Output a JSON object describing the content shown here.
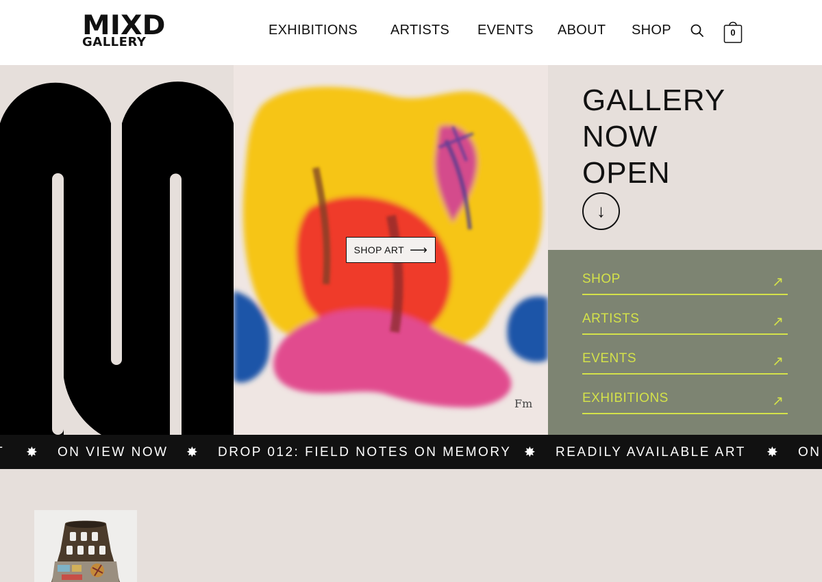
{
  "header": {
    "logo": {
      "main": "MIXD",
      "sub": "GALLERY"
    },
    "nav": [
      {
        "label": "EXHIBITIONS"
      },
      {
        "label": "ARTISTS"
      },
      {
        "label": "EVENTS"
      },
      {
        "label": "ABOUT"
      },
      {
        "label": "SHOP"
      }
    ],
    "search_icon": "search-icon",
    "cart": {
      "icon": "shopping-bag-icon",
      "count": "0"
    }
  },
  "hero": {
    "shop_button": {
      "label": "SHOP ART",
      "arrow": "⟶"
    },
    "title_lines": [
      "GALLERY",
      "NOW",
      "OPEN"
    ],
    "down_arrow": "↓"
  },
  "quick_links": [
    {
      "label": "SHOP",
      "arrow": "↗"
    },
    {
      "label": "ARTISTS",
      "arrow": "↗"
    },
    {
      "label": "EVENTS",
      "arrow": "↗"
    },
    {
      "label": "EXHIBITIONS",
      "arrow": "↗"
    }
  ],
  "marquee": {
    "leading": "T",
    "star": "✸",
    "items": [
      "ON VIEW NOW",
      "DROP 012: FIELD NOTES ON MEMORY",
      "READILY AVAILABLE ART",
      "ON"
    ]
  },
  "colors": {
    "background": "#e6dfdb",
    "header_bg": "#ffffff",
    "quick_links_bg": "#7d8472",
    "quick_links_accent": "#d4e24a",
    "marquee_bg": "#111111"
  }
}
